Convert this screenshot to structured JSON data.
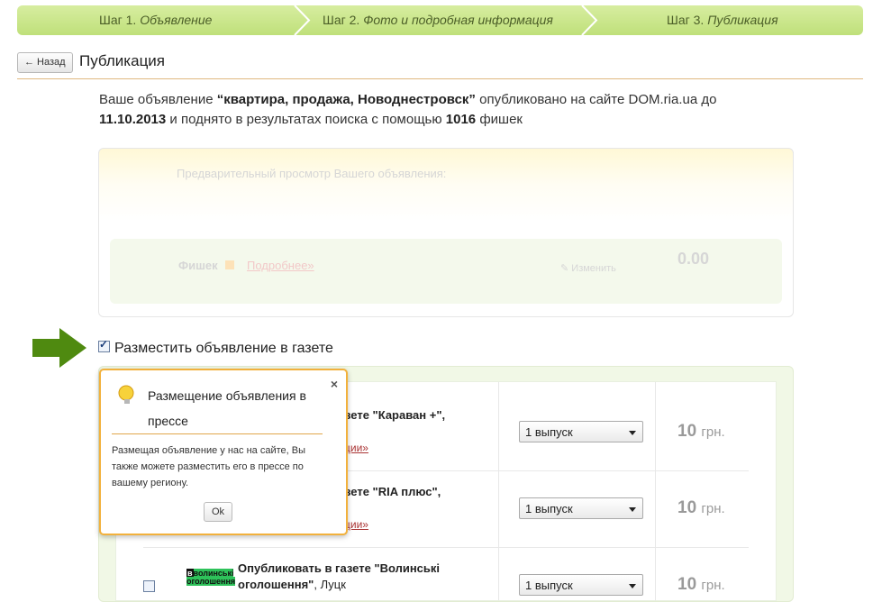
{
  "steps": [
    {
      "prefix": "Шаг 1.",
      "name": "Объявление"
    },
    {
      "prefix": "Шаг 2.",
      "name": "Фото и подробная информация"
    },
    {
      "prefix": "Шаг 3.",
      "name": "Публикация"
    }
  ],
  "header": {
    "back_label": "← Назад",
    "title": "Публикация"
  },
  "lead": {
    "part1": "Ваше объявление ",
    "ad_name": "“квартира, продажа, Новоднестровск”",
    "part2": " опубликовано на сайте DOM.ria.ua до",
    "date": "11.10.2013",
    "part3": " и поднято в результатах поиска с помощью ",
    "chips": "1016",
    "part4": " фишек"
  },
  "preview": {
    "heading": "Предварительный просмотр Вашего объявления:",
    "chips_label": "Фишек",
    "more": "Подробнее»",
    "edit": "Изменить",
    "amount": "0.00"
  },
  "newspaper": {
    "checkbox_label": "Разместить объявление в газете",
    "checked": true,
    "rows": [
      {
        "title_tail": "зете \"Караван +\",",
        "more": "ции»",
        "issues": "1 выпуск",
        "price": "10",
        "currency": "грн."
      },
      {
        "title_tail": "зете \"RIA плюс\",",
        "more": "ции»",
        "issues": "1 выпуск",
        "price": "10",
        "currency": "грн."
      },
      {
        "logo": "волинські оголошення",
        "title": "Опубликовать в газете \"Волинські оголошення\"",
        "city": ", Луцк",
        "issues": "1 выпуск",
        "price": "10",
        "currency": "грн."
      }
    ]
  },
  "tooltip": {
    "heading": "Размещение объявления в прессе",
    "text": "Размещая объявление у нас на сайте, Вы также можете разместить его в прессе по вашему региону.",
    "ok": "Ok",
    "close": "×"
  },
  "colors": {
    "accent_green": "#4f8a10",
    "steps_bg": "#c6e384",
    "tooltip_border": "#f2b13c"
  }
}
